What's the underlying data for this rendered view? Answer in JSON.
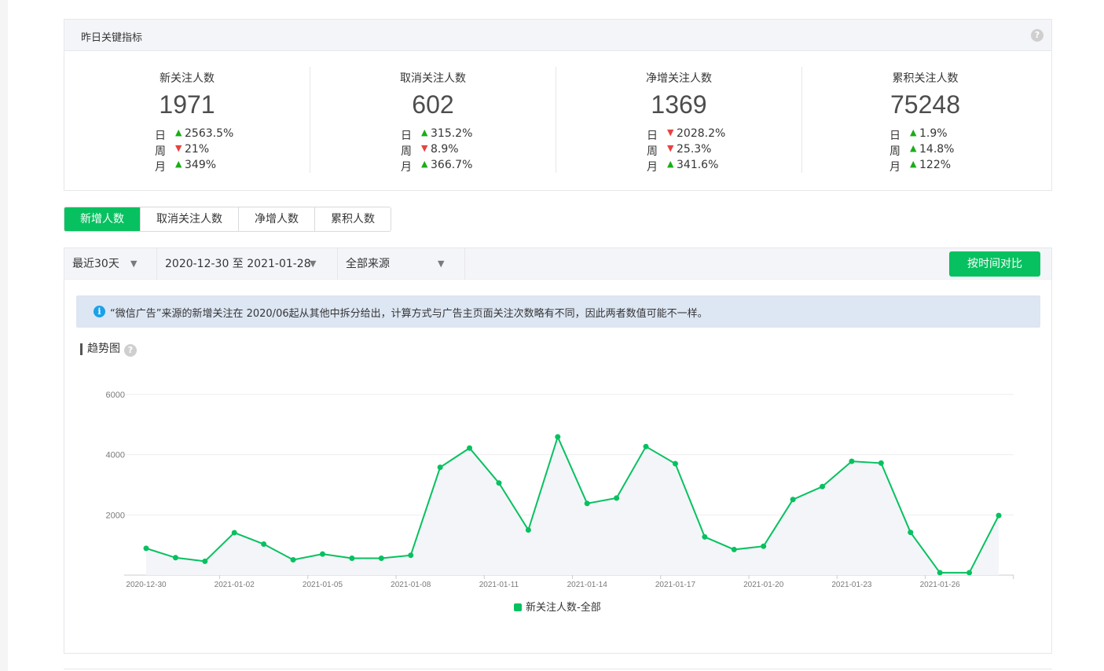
{
  "kpi": {
    "title": "昨日关键指标",
    "help": "?",
    "cards": [
      {
        "label": "新关注人数",
        "value": "1971",
        "stats": [
          {
            "period": "日",
            "dir": "up",
            "pct": "2563.5%"
          },
          {
            "period": "周",
            "dir": "down",
            "pct": "21%"
          },
          {
            "period": "月",
            "dir": "up",
            "pct": "349%"
          }
        ]
      },
      {
        "label": "取消关注人数",
        "value": "602",
        "stats": [
          {
            "period": "日",
            "dir": "up",
            "pct": "315.2%"
          },
          {
            "period": "周",
            "dir": "down",
            "pct": "8.9%"
          },
          {
            "period": "月",
            "dir": "up",
            "pct": "366.7%"
          }
        ]
      },
      {
        "label": "净增关注人数",
        "value": "1369",
        "stats": [
          {
            "period": "日",
            "dir": "down",
            "pct": "2028.2%"
          },
          {
            "period": "周",
            "dir": "down",
            "pct": "25.3%"
          },
          {
            "period": "月",
            "dir": "up",
            "pct": "341.6%"
          }
        ]
      },
      {
        "label": "累积关注人数",
        "value": "75248",
        "stats": [
          {
            "period": "日",
            "dir": "up",
            "pct": "1.9%"
          },
          {
            "period": "周",
            "dir": "up",
            "pct": "14.8%"
          },
          {
            "period": "月",
            "dir": "up",
            "pct": "122%"
          }
        ]
      }
    ]
  },
  "tabs": [
    "新增人数",
    "取消关注人数",
    "净增人数",
    "累积人数"
  ],
  "active_tab": 0,
  "filters": {
    "range": "最近30天",
    "dates": "2020-12-30 至 2021-01-28",
    "source": "全部来源",
    "compare_button": "按时间对比"
  },
  "notice": "“微信广告”来源的新增关注在 2020/06起从其他中拆分给出，计算方式与广告主页面关注次数略有不同，因此两者数值可能不一样。",
  "trend_title": "趋势图",
  "colors": {
    "accent": "#07c160",
    "up": "#1aad19",
    "down": "#e64340"
  },
  "chart_data": {
    "type": "area",
    "x": [
      "2020-12-30",
      "2020-12-31",
      "2021-01-01",
      "2021-01-02",
      "2021-01-03",
      "2021-01-04",
      "2021-01-05",
      "2021-01-06",
      "2021-01-07",
      "2021-01-08",
      "2021-01-09",
      "2021-01-10",
      "2021-01-11",
      "2021-01-12",
      "2021-01-13",
      "2021-01-14",
      "2021-01-15",
      "2021-01-16",
      "2021-01-17",
      "2021-01-18",
      "2021-01-19",
      "2021-01-20",
      "2021-01-21",
      "2021-01-22",
      "2021-01-23",
      "2021-01-24",
      "2021-01-25",
      "2021-01-26",
      "2021-01-27",
      "2021-01-28"
    ],
    "x_tick_labels": [
      "2020-12-30",
      "2021-01-02",
      "2021-01-05",
      "2021-01-08",
      "2021-01-11",
      "2021-01-14",
      "2021-01-17",
      "2021-01-20",
      "2021-01-23",
      "2021-01-26"
    ],
    "series": [
      {
        "name": "新关注人数-全部",
        "values": [
          890,
          580,
          460,
          1410,
          1030,
          510,
          700,
          560,
          560,
          660,
          3580,
          4220,
          3060,
          1500,
          4590,
          2380,
          2560,
          4270,
          3700,
          1270,
          850,
          960,
          2510,
          2940,
          3780,
          3720,
          1420,
          80,
          80,
          1980
        ]
      }
    ],
    "y_ticks": [
      2000,
      4000,
      6000
    ],
    "ylim": [
      0,
      6000
    ],
    "legend": "bottom-center",
    "grid": true
  }
}
